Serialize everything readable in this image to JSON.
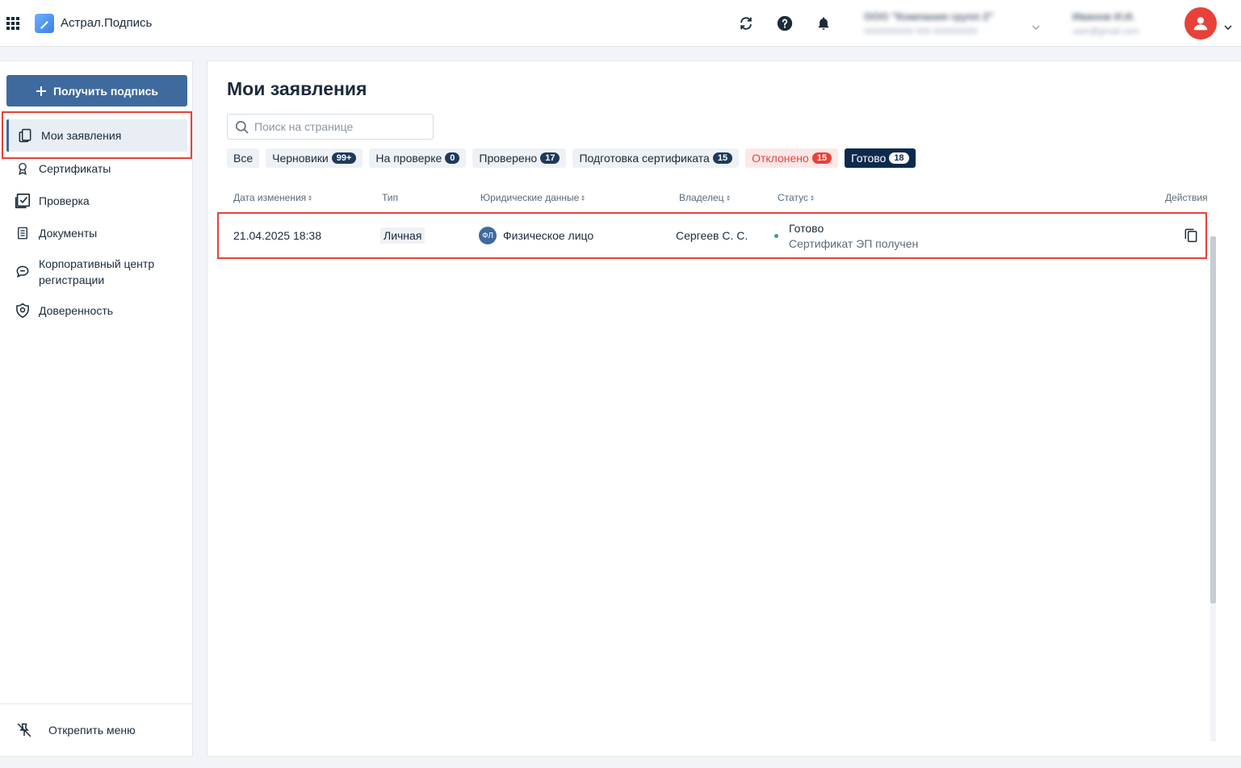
{
  "header": {
    "app_title": "Астрал.Подпись",
    "icons": [
      "apps-grid-icon",
      "app-logo-icon",
      "refresh-icon",
      "help-icon",
      "bell-icon",
      "chevron-down-icon",
      "user-avatar-icon"
    ],
    "org_name": "ООО \"Компания групп 2\"",
    "org_sub": "0000000000 000 000000000",
    "user_name": "Иванов И.И.",
    "user_email": "user@gmail.com"
  },
  "sidebar": {
    "get_signature_label": "Получить подпись",
    "items": [
      {
        "label": "Мои заявления",
        "icon": "documents-copy-icon"
      },
      {
        "label": "Сертификаты",
        "icon": "award-icon"
      },
      {
        "label": "Проверка",
        "icon": "checkbox-check-icon"
      },
      {
        "label": "Документы",
        "icon": "document-icon"
      },
      {
        "label": "Корпоративный центр регистрации",
        "icon": "chat-bubble-icon"
      },
      {
        "label": "Доверенность",
        "icon": "shield-icon"
      }
    ],
    "unpin_label": "Открепить меню"
  },
  "main": {
    "title": "Мои заявления",
    "search_placeholder": "Поиск на странице",
    "filters": [
      {
        "label": "Все",
        "count": ""
      },
      {
        "label": "Черновики",
        "count": "99+"
      },
      {
        "label": "На проверке",
        "count": "0"
      },
      {
        "label": "Проверено",
        "count": "17"
      },
      {
        "label": "Подготовка сертификата",
        "count": "15"
      },
      {
        "label": "Отклонено",
        "count": "15"
      },
      {
        "label": "Готово",
        "count": "18"
      }
    ],
    "columns": [
      "Дата изменения",
      "Тип",
      "Юридические данные",
      "Владелец",
      "Статус",
      "Действия"
    ],
    "rows": [
      {
        "date": "21.04.2025 18:38",
        "type": "Личная",
        "legal_badge": "ФЛ",
        "legal": "Физическое лицо",
        "owner": "Сергеев С. С.",
        "status": "Готово",
        "status_sub": "Сертификат ЭП получен"
      }
    ]
  },
  "colors": {
    "accent": "#3e6a9e",
    "dark_navy": "#0d2a4d",
    "danger": "#e8413a",
    "success": "#3aa76d"
  }
}
